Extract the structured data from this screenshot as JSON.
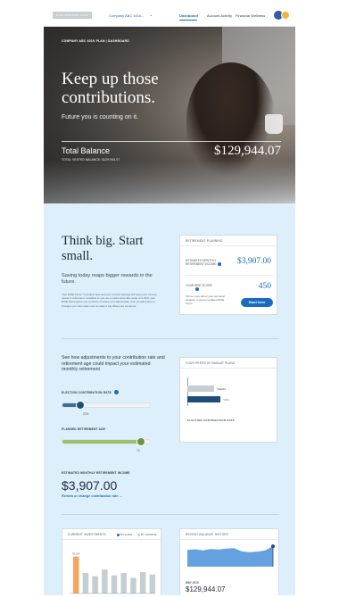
{
  "header": {
    "logo_text": "PLAN SPONSOR LOGO",
    "company_select": "Company ABC 401k...",
    "nav": {
      "dashboard": "Dashboard",
      "account_activity": "Account Activity",
      "financial_wellness": "Financial Wellness"
    }
  },
  "hero": {
    "breadcrumb": "COMPANY ABC 401K PLAN | DASHBOARD",
    "title": "Keep up those contributions.",
    "subtitle": "Future you is counting on it.",
    "balance_label": "Total Balance",
    "vested_label": "TOTAL VESTED BALANCE: $129,944.07",
    "balance_value": "$129,944.07"
  },
  "intro": {
    "title": "Think big. Start small.",
    "subtitle": "Saving today reaps bigger rewards in the future.",
    "description": "Your RISE Score™ predicts how well your current savings will meet your income needs in retirement. Available to you via a credit score-like scale of 0–850, your RISE Score gives you a picture of where you stand today, then provides tips on changes you can make now to make a big difference tomorrow."
  },
  "planning_card": {
    "heading": "RETIREMENT PLANNING",
    "est_income_label": "ESTIMATED MONTHLY RETIREMENT INCOME",
    "est_income_value": "$3,907.00",
    "rise_label": "YOUR RISE SCORE",
    "rise_value": "450",
    "rise_desc": "Tell us more about your personal situation to get an updated RISE Score.",
    "start_button": "Start here"
  },
  "adjust": {
    "text": "See how adjustments to your contribution rate and retirement age could impact your estimated monthly retirement",
    "contrib_label": "ELECTION CONTRIBUTION RATE",
    "contrib_value": "20%",
    "contrib_fraction": 0.2,
    "retire_label": "PLANNED RETIREMENT AGE",
    "retire_value": "75",
    "retire_fraction": 0.88,
    "est_monthly_label": "ESTIMATED MONTHLY RETIREMENT INCOME",
    "est_monthly_value": "$3,907.00",
    "review_link": "Review or change contribution rate →"
  },
  "peers_card": {
    "heading": "YOUR PEERS IN SIMILAR PLANS",
    "bars": [
      {
        "name": "PEERS",
        "fraction": 0.5
      },
      {
        "name": "YOU",
        "fraction": 0.62
      }
    ],
    "caption": "ELECTION CONTRIBUTION RATE"
  },
  "investments_card": {
    "heading": "CURRENT INVESTMENTS",
    "legend_fund": "BY FUND",
    "legend_source": "BY SOURCE",
    "top_label": "30.2%",
    "bars": [
      0.9,
      0.5,
      0.42,
      0.58,
      0.44,
      0.5,
      0.38,
      0.52,
      0.46
    ]
  },
  "history_card": {
    "heading": "RECENT BALANCE HISTORY",
    "series": [
      0.72,
      0.75,
      0.7,
      0.76,
      0.74,
      0.78,
      0.8,
      0.66,
      0.62,
      0.65,
      0.7,
      0.88
    ],
    "date": "MAY 2019",
    "value": "$129,944.07"
  },
  "colors": {
    "accent": "#1a6bbf",
    "navy": "#1f4d7a",
    "green": "#9bbf6e",
    "highlight": "#f4a75d",
    "page_bg": "#ddeffb"
  }
}
